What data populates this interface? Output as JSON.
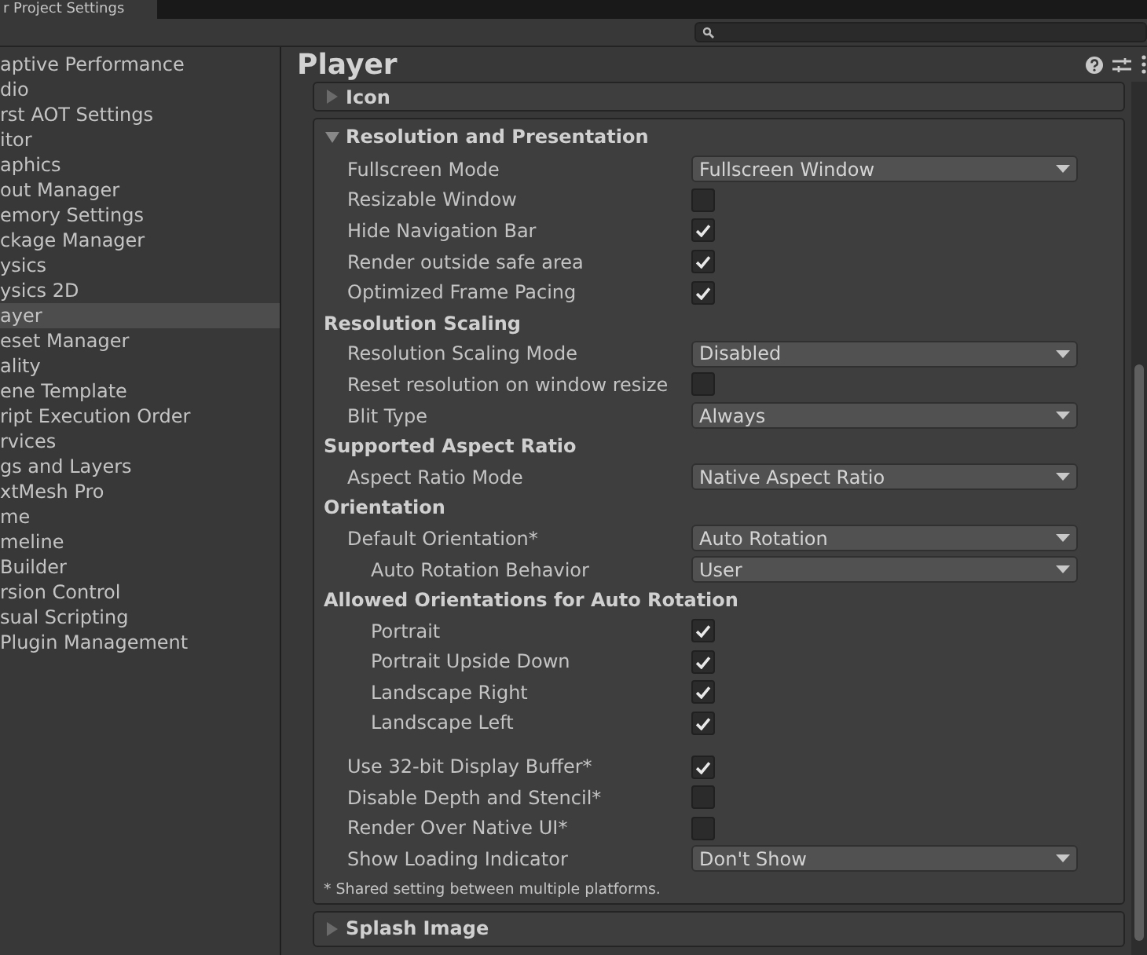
{
  "window": {
    "title": "r Project Settings"
  },
  "sidebar": {
    "items": [
      {
        "label": "aptive Performance",
        "selected": false
      },
      {
        "label": "dio",
        "selected": false
      },
      {
        "label": "rst AOT Settings",
        "selected": false
      },
      {
        "label": "itor",
        "selected": false
      },
      {
        "label": "aphics",
        "selected": false
      },
      {
        "label": "out Manager",
        "selected": false
      },
      {
        "label": "emory Settings",
        "selected": false
      },
      {
        "label": "ckage Manager",
        "selected": false
      },
      {
        "label": "ysics",
        "selected": false
      },
      {
        "label": "ysics 2D",
        "selected": false
      },
      {
        "label": "ayer",
        "selected": true
      },
      {
        "label": "eset Manager",
        "selected": false
      },
      {
        "label": "ality",
        "selected": false
      },
      {
        "label": "ene Template",
        "selected": false
      },
      {
        "label": "ript Execution Order",
        "selected": false
      },
      {
        "label": "rvices",
        "selected": false
      },
      {
        "label": "gs and Layers",
        "selected": false
      },
      {
        "label": "xtMesh Pro",
        "selected": false
      },
      {
        "label": "me",
        "selected": false
      },
      {
        "label": "meline",
        "selected": false
      },
      {
        "label": " Builder",
        "selected": false
      },
      {
        "label": "rsion Control",
        "selected": false
      },
      {
        "label": "sual Scripting",
        "selected": false
      },
      {
        "label": " Plugin Management",
        "selected": false
      }
    ]
  },
  "page": {
    "title": "Player"
  },
  "sections_before": [
    {
      "title": "Icon",
      "expanded": false
    }
  ],
  "section": {
    "title": "Resolution and Presentation",
    "expanded": true,
    "rows": [
      {
        "kind": "dropdown",
        "label": "Fullscreen Mode",
        "value": "Fullscreen Window"
      },
      {
        "kind": "checkbox",
        "label": "Resizable Window",
        "checked": false
      },
      {
        "kind": "checkbox",
        "label": "Hide Navigation Bar",
        "checked": true
      },
      {
        "kind": "checkbox",
        "label": "Render outside safe area",
        "checked": true
      },
      {
        "kind": "checkbox",
        "label": "Optimized Frame Pacing",
        "checked": true
      },
      {
        "kind": "header",
        "label": "Resolution Scaling"
      },
      {
        "kind": "dropdown",
        "label": "Resolution Scaling Mode",
        "value": "Disabled"
      },
      {
        "kind": "checkbox",
        "label": "Reset resolution on window resize",
        "checked": false
      },
      {
        "kind": "dropdown",
        "label": "Blit Type",
        "value": "Always"
      },
      {
        "kind": "header",
        "label": "Supported Aspect Ratio"
      },
      {
        "kind": "dropdown",
        "label": "Aspect Ratio Mode",
        "value": "Native Aspect Ratio"
      },
      {
        "kind": "header",
        "label": "Orientation"
      },
      {
        "kind": "dropdown",
        "label": "Default Orientation*",
        "value": "Auto Rotation"
      },
      {
        "kind": "subdropdown",
        "label": "Auto Rotation Behavior",
        "value": "User"
      },
      {
        "kind": "header",
        "label": "Allowed Orientations for Auto Rotation"
      },
      {
        "kind": "subcheckbox",
        "label": "Portrait",
        "checked": true
      },
      {
        "kind": "subcheckbox",
        "label": "Portrait Upside Down",
        "checked": true
      },
      {
        "kind": "subcheckbox",
        "label": "Landscape Right",
        "checked": true
      },
      {
        "kind": "subcheckbox",
        "label": "Landscape Left",
        "checked": true
      },
      {
        "kind": "gap"
      },
      {
        "kind": "checkbox",
        "label": "Use 32-bit Display Buffer*",
        "checked": true
      },
      {
        "kind": "checkbox",
        "label": "Disable Depth and Stencil*",
        "checked": false
      },
      {
        "kind": "checkbox",
        "label": "Render Over Native UI*",
        "checked": false
      },
      {
        "kind": "dropdown",
        "label": "Show Loading Indicator",
        "value": "Don't Show"
      }
    ],
    "note": "* Shared setting between multiple platforms."
  },
  "sections_after": [
    {
      "title": "Splash Image",
      "expanded": false
    }
  ]
}
